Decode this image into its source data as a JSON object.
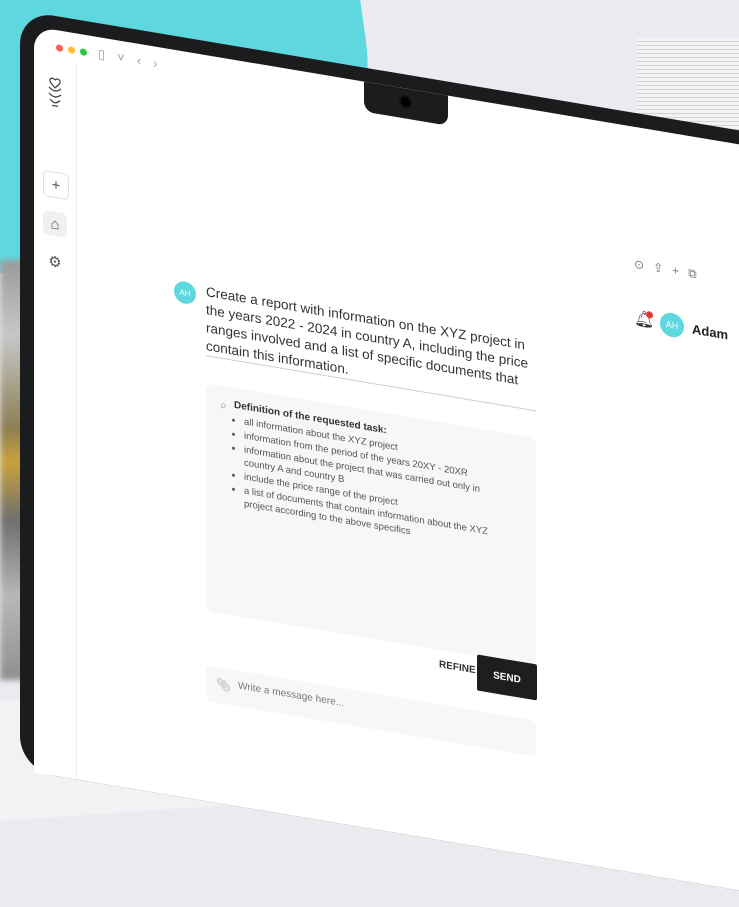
{
  "window": {
    "traffic_colors": [
      "#ff5f57",
      "#febc2e",
      "#28c840"
    ],
    "toolbar_icons": [
      "sidebar-toggle-icon",
      "chevron-down-icon",
      "back-icon",
      "forward-icon"
    ],
    "toolbar_glyphs": [
      "▯",
      "˅",
      "‹",
      "›"
    ],
    "right_tools": [
      "history-icon",
      "share-icon",
      "new-tab-icon",
      "copy-icon"
    ],
    "right_tool_glyphs": [
      "⊙",
      "⇪",
      "+",
      "⧉"
    ]
  },
  "sidebar": {
    "items": [
      {
        "name": "new-chat-button",
        "glyph": "+"
      },
      {
        "name": "home-button",
        "glyph": "⌂"
      },
      {
        "name": "settings-button",
        "glyph": "⚙"
      }
    ]
  },
  "header": {
    "user_name": "Adam",
    "user_initials": "AH"
  },
  "conversation": {
    "user_initials": "AH",
    "prompt": "Create a report with information on the XYZ project in the years 2022 - 2024 in country A, including the price ranges involved and a list of specific documents that contain this information.",
    "task_title": "Definition of the requested task:",
    "task_items": [
      "all information about the XYZ project",
      "information from the period of the years 20XY - 20XR",
      "information about the project that was carried out only in country A and country B",
      "include the price range of the project",
      "a list of documents that contain information about the XYZ project according to the above specifics"
    ]
  },
  "actions": {
    "refine_label": "REFINE",
    "send_label": "SEND"
  },
  "composer": {
    "placeholder": "Write a message here..."
  },
  "colors": {
    "accent": "#5fd7df",
    "send_bg": "#1e1e1e",
    "notification": "#e53935"
  }
}
